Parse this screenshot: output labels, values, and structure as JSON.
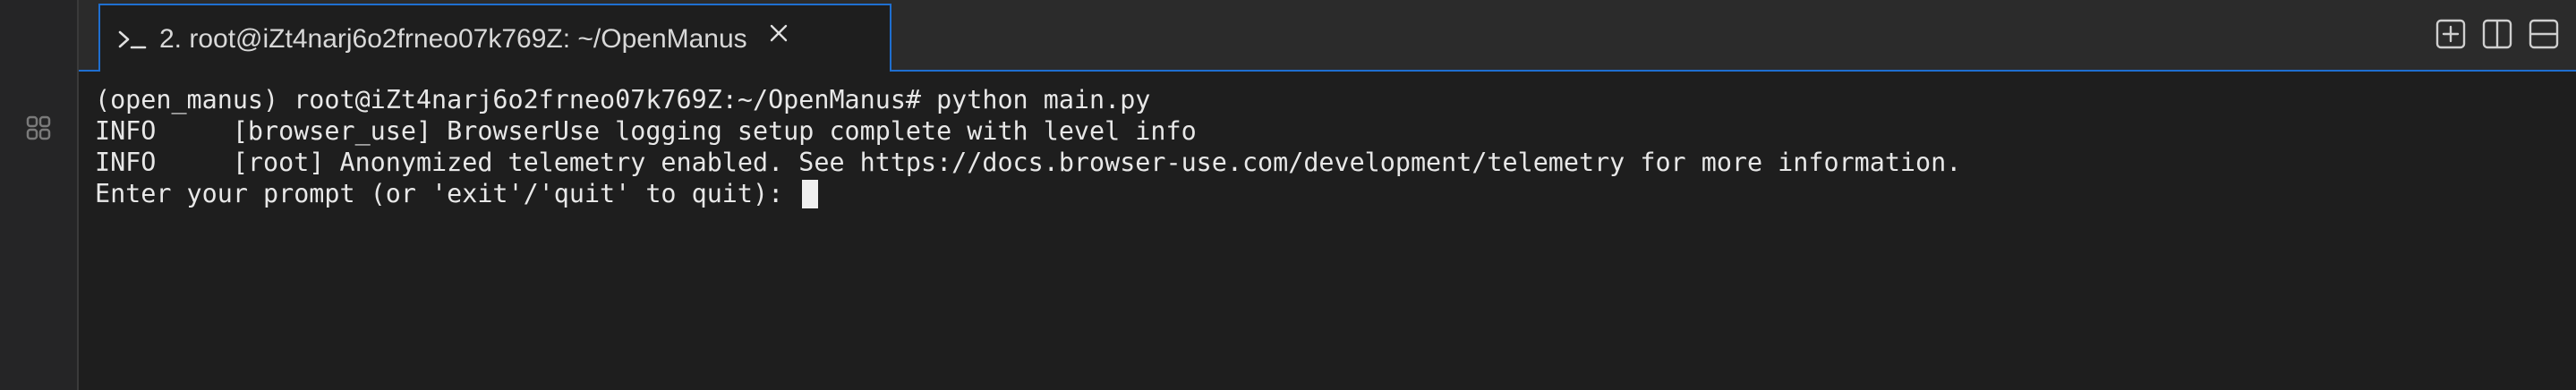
{
  "tab": {
    "title": "2. root@iZt4narj6o2frneo07k769Z: ~/OpenManus"
  },
  "terminal": {
    "lines": [
      {
        "text": "(open_manus) root@iZt4narj6o2frneo07k769Z:~/OpenManus# python main.py"
      },
      {
        "text": "INFO     [browser_use] BrowserUse logging setup complete with level info"
      },
      {
        "text": "INFO     [root] Anonymized telemetry enabled. See https://docs.browser-use.com/development/telemetry for more information."
      },
      {
        "text": "Enter your prompt (or 'exit'/'quit' to quit): "
      }
    ]
  },
  "icons": {
    "activity_terminal": "terminal-icon",
    "activity_extensions": "extensions-icon",
    "tab_prompt": "prompt-icon",
    "tab_close": "close-icon",
    "new_tab": "plus-square-icon",
    "split_vertical": "split-vertical-icon",
    "split_horizontal": "split-horizontal-icon"
  },
  "colors": {
    "accent": "#1f6fd0",
    "background": "#1e1e1e",
    "text": "#e8e8e8"
  }
}
